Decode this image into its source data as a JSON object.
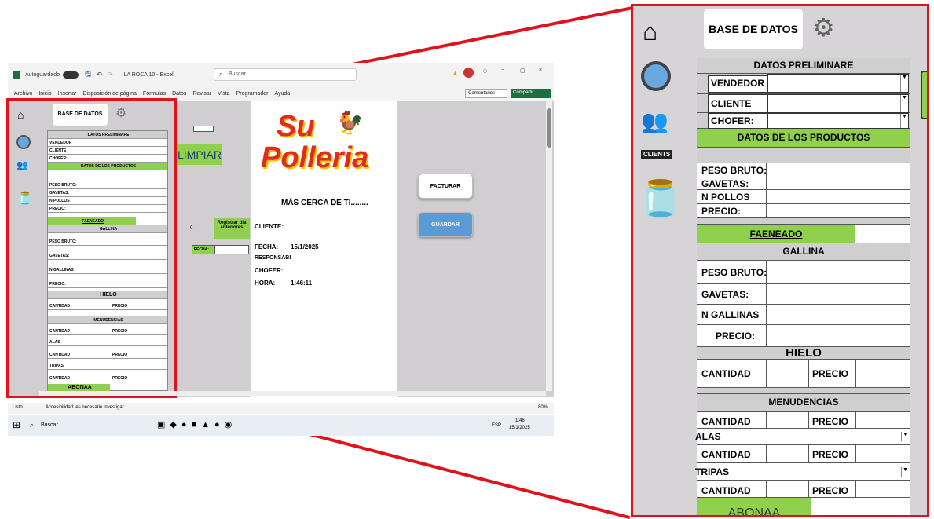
{
  "excel": {
    "title_left": "Autoguardado",
    "file_title": "LA ROCA 10 - Excel",
    "search_placeholder": "Buscar",
    "menu": [
      "Archivo",
      "Inicio",
      "Insertar",
      "Disposición de página",
      "Fórmulas",
      "Datos",
      "Revisar",
      "Vista",
      "Programador",
      "Ayuda"
    ],
    "comments": "Comentarios",
    "share": "Compartir",
    "status_left": "Listo",
    "accessibility": "Accesibilidad: es necesario investigar",
    "zoom_level": "80%",
    "taskbar_search": "Buscar",
    "clock_time": "1:46",
    "clock_date": "15/1/2025",
    "lang": "ESP"
  },
  "sheet": {
    "limpiar": "LIMPIAR",
    "registrar": "Registrar día anteriores",
    "zero": "0",
    "fecha_label": "FECHA:",
    "brand_top": "Su",
    "brand_bottom": "Polleria",
    "slogan": "MÁS CERCA DE TI........",
    "cliente": "CLIENTE:",
    "fecha": "FECHA:",
    "fecha_val": "15/1/2025",
    "responsable": "RESPONSABI",
    "chofer": "CHOFER:",
    "hora": "HORA:",
    "hora_val": "1:46:11",
    "facturar": "FACTURAR",
    "guardar": "GUARDAR"
  },
  "form": {
    "base_datos": "BASE DE DATOS",
    "clients": "CLIENTS",
    "datos_prelim": "DATOS PRELIMINARE",
    "vendedor": "VENDEDOR",
    "cliente": "CLIENTE",
    "chofer": "CHOFER:",
    "datos_productos": "DATOS DE LOS PRODUCTOS",
    "peso_bruto": "PESO BRUTO:",
    "gavetas": "GAVETAS:",
    "n_pollos": "N POLLOS",
    "precio": "PRECIO:",
    "faeneado": "FAENEADO",
    "gallina": "GALLINA",
    "n_gallinas": "N GALLINAS",
    "hielo": "HIELO",
    "cantidad": "CANTIDAD",
    "precio2": "PRECIO",
    "menudencias": "MENUDENCIAS",
    "alas": "ALAS",
    "tripas": "TRIPAS",
    "abonaa": "ABONAA"
  },
  "colors": {
    "green": "#8fd14f",
    "red": "#e0121b",
    "blue": "#5b9bd5"
  },
  "icons": [
    "home-icon",
    "database-gear-icon",
    "people-circle-icon",
    "clients-icon",
    "food-jars-icon"
  ]
}
